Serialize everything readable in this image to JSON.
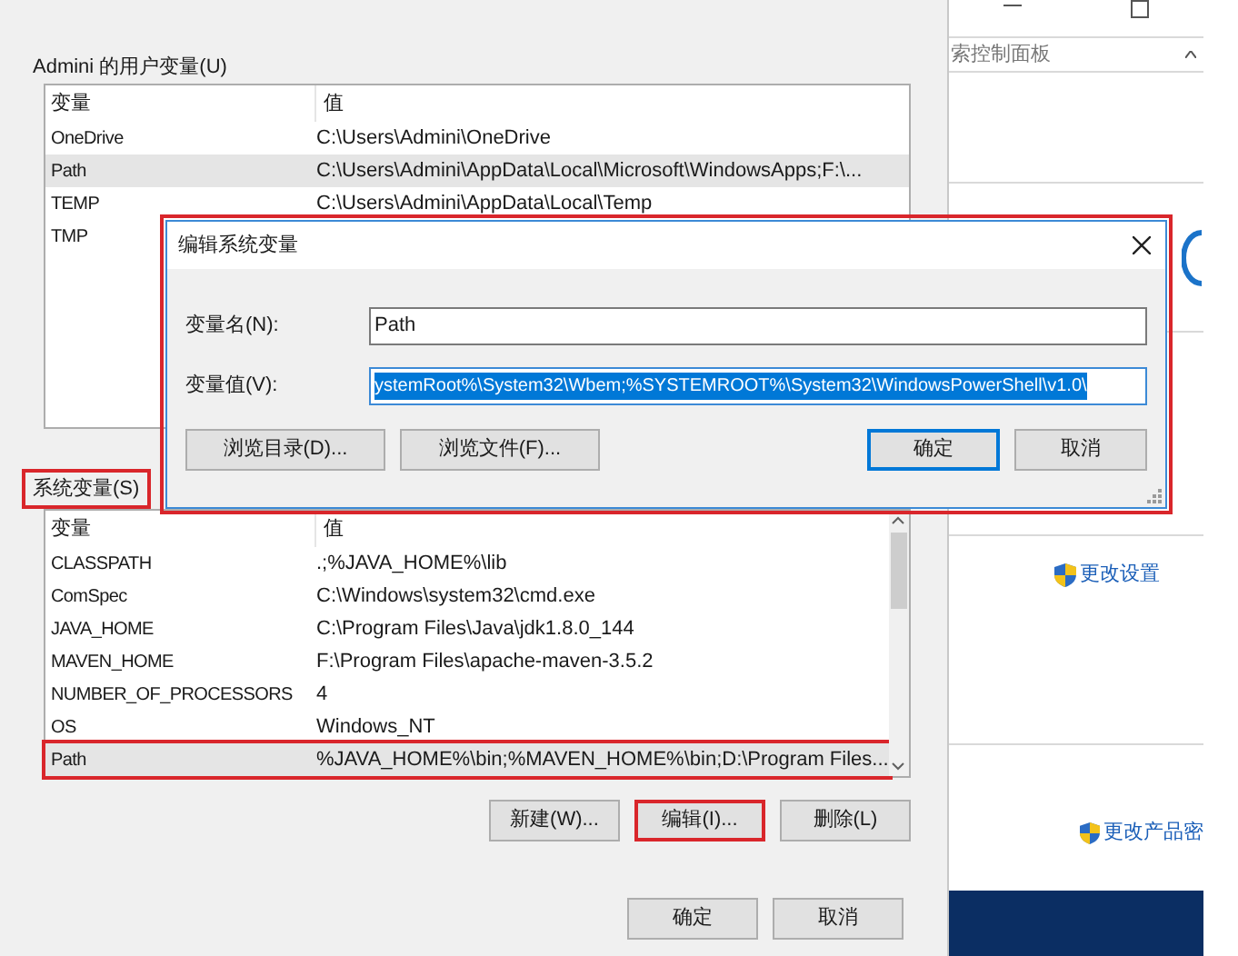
{
  "user_vars": {
    "label": "Admini 的用户变量(U)",
    "columns": [
      "变量",
      "值"
    ],
    "rows": [
      {
        "name": "OneDrive",
        "value": "C:\\Users\\Admini\\OneDrive",
        "selected": false
      },
      {
        "name": "Path",
        "value": "C:\\Users\\Admini\\AppData\\Local\\Microsoft\\WindowsApps;F:\\...",
        "selected": true
      },
      {
        "name": "TEMP",
        "value": "C:\\Users\\Admini\\AppData\\Local\\Temp",
        "selected": false
      },
      {
        "name": "TMP",
        "selected": false
      }
    ]
  },
  "system_vars": {
    "label": "系统变量(S)",
    "annotated": true,
    "columns": [
      "变量",
      "值"
    ],
    "rows": [
      {
        "name": "CLASSPATH",
        "value": ".;%JAVA_HOME%\\lib",
        "selected": false,
        "annotated": false
      },
      {
        "name": "ComSpec",
        "value": "C:\\Windows\\system32\\cmd.exe",
        "selected": false,
        "annotated": false
      },
      {
        "name": "JAVA_HOME",
        "value": "C:\\Program Files\\Java\\jdk1.8.0_144",
        "selected": false,
        "annotated": false
      },
      {
        "name": "MAVEN_HOME",
        "value": "F:\\Program Files\\apache-maven-3.5.2",
        "selected": false,
        "annotated": false
      },
      {
        "name": "NUMBER_OF_PROCESSORS",
        "value": "4",
        "selected": false,
        "annotated": false
      },
      {
        "name": "OS",
        "value": "Windows_NT",
        "selected": false,
        "annotated": false
      },
      {
        "name": "Path",
        "value": "%JAVA_HOME%\\bin;%MAVEN_HOME%\\bin;D:\\Program Files...",
        "selected": true,
        "annotated": true
      }
    ],
    "buttons": [
      {
        "label": "新建(W)...",
        "annotated": false
      },
      {
        "label": "编辑(I)...",
        "annotated": true
      },
      {
        "label": "删除(L)",
        "annotated": false
      }
    ]
  },
  "dialog_buttons": [
    "确定",
    "取消"
  ],
  "background_window": {
    "search_placeholder": "索控制面板",
    "links": [
      "更改设置",
      "更改产品密"
    ]
  },
  "edit_dialog": {
    "title": "编辑系统变量",
    "annotated": true,
    "fields": [
      {
        "label": "变量名(N):",
        "value": "Path",
        "selected": false
      },
      {
        "label": "变量值(V):",
        "value": "ystemRoot%\\System32\\Wbem;%SYSTEMROOT%\\System32\\WindowsPowerShell\\v1.0\\",
        "selected": true
      }
    ],
    "buttons": [
      {
        "label": "浏览目录(D)...",
        "default": false
      },
      {
        "label": "浏览文件(F)...",
        "default": false
      },
      {
        "label": "确定",
        "default": true
      },
      {
        "label": "取消",
        "default": false
      }
    ]
  }
}
